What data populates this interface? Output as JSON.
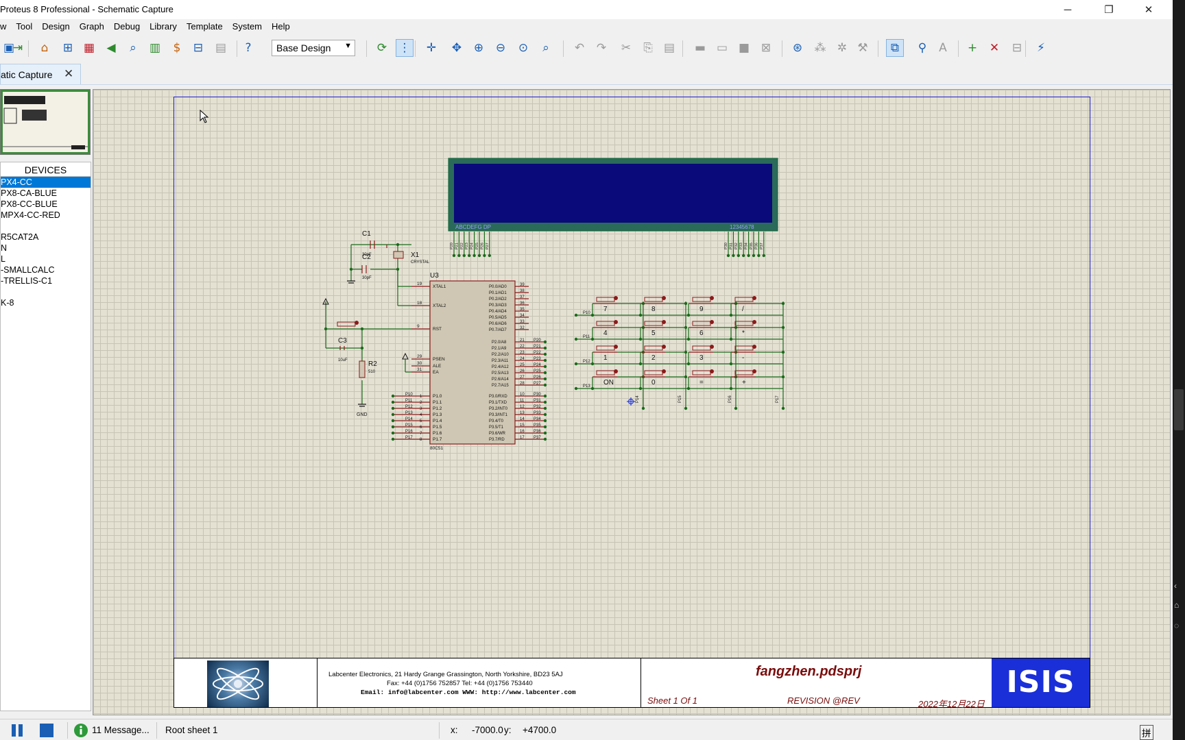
{
  "window": {
    "title": "Proteus 8 Professional - Schematic Capture",
    "minimize": "─",
    "maximize": "❐",
    "close": "✕"
  },
  "menu": [
    "w",
    "Tool",
    "Design",
    "Graph",
    "Debug",
    "Library",
    "Template",
    "System",
    "Help"
  ],
  "toolbar": {
    "design_select": "Base Design",
    "icons": [
      "save-icon",
      "import-icon",
      "home-icon",
      "pcb-icon",
      "chip-icon",
      "back-icon",
      "zoom-search-icon",
      "gerber-icon",
      "bom-icon",
      "binary-icon",
      "document-icon",
      "help-icon",
      "refresh-icon",
      "grid-icon",
      "origin-icon",
      "pan-icon",
      "zoom-in-icon",
      "zoom-out-icon",
      "zoom-all-icon",
      "zoom-area-icon",
      "undo-icon",
      "redo-icon",
      "cut-icon",
      "copy-icon",
      "paste-icon",
      "block-copy-icon",
      "block-move-icon",
      "block-rotate-icon",
      "block-delete-icon",
      "pick-device-icon",
      "make-device-icon",
      "package-tool-icon",
      "decompose-icon",
      "wire-autorouter-icon",
      "search-tag-icon",
      "property-assign-icon",
      "new-sheet-icon",
      "remove-sheet-icon",
      "exit-parent-icon",
      "electrical-rule-icon"
    ]
  },
  "tab": {
    "label": "atic Capture",
    "close": "✕"
  },
  "devices": {
    "header": "DEVICES",
    "items": [
      "PX4-CC",
      "PX8-CA-BLUE",
      "PX8-CC-BLUE",
      "MPX4-CC-RED",
      "",
      "R5CAT2A",
      "N",
      "L",
      "-SMALLCALC",
      "-TRELLIS-C1",
      "",
      "K-8"
    ],
    "selected_index": 0
  },
  "schematic": {
    "lcd": {
      "left_label": "ABCDEFG DP",
      "right_label": "12345678",
      "color": "#0a0a7a"
    },
    "components": {
      "c1": "C1",
      "c1_val": "30pF",
      "c2": "C2",
      "c2_val": "30pF",
      "x1": "X1",
      "x1_val": "CRYSTAL",
      "c3": "C3",
      "c3_val": "10uF",
      "r2": "R2",
      "r2_val": "510",
      "gnd": "GND",
      "u3": "U3",
      "u3_part": "80C51"
    },
    "mcu_left_pins": [
      {
        "num": "19",
        "name": "XTAL1"
      },
      {
        "num": "18",
        "name": "XTAL2"
      },
      {
        "num": "9",
        "name": "RST"
      },
      {
        "num": "29",
        "name": "PSEN"
      },
      {
        "num": "30",
        "name": "ALE"
      },
      {
        "num": "31",
        "name": "EA"
      }
    ],
    "mcu_p1_pins": [
      {
        "num": "1",
        "name": "P1.0",
        "net": "P10"
      },
      {
        "num": "2",
        "name": "P1.1",
        "net": "P11"
      },
      {
        "num": "3",
        "name": "P1.2",
        "net": "P12"
      },
      {
        "num": "4",
        "name": "P1.3",
        "net": "P13"
      },
      {
        "num": "5",
        "name": "P1.4",
        "net": "P14"
      },
      {
        "num": "6",
        "name": "P1.5",
        "net": "P15"
      },
      {
        "num": "7",
        "name": "P1.6",
        "net": "P16"
      },
      {
        "num": "8",
        "name": "P1.7",
        "net": "P17"
      }
    ],
    "mcu_p0_pins": [
      {
        "num": "39",
        "name": "P0.0/AD0"
      },
      {
        "num": "38",
        "name": "P0.1/AD1"
      },
      {
        "num": "37",
        "name": "P0.2/AD2"
      },
      {
        "num": "36",
        "name": "P0.3/AD3"
      },
      {
        "num": "35",
        "name": "P0.4/AD4"
      },
      {
        "num": "34",
        "name": "P0.5/AD5"
      },
      {
        "num": "33",
        "name": "P0.6/AD6"
      },
      {
        "num": "32",
        "name": "P0.7/AD7"
      }
    ],
    "mcu_p2_pins": [
      {
        "num": "21",
        "name": "P2.0/A8",
        "net": "P20"
      },
      {
        "num": "22",
        "name": "P2.1/A9",
        "net": "P21"
      },
      {
        "num": "23",
        "name": "P2.2/A10",
        "net": "P22"
      },
      {
        "num": "24",
        "name": "P2.3/A11",
        "net": "P23"
      },
      {
        "num": "25",
        "name": "P2.4/A12",
        "net": "P24"
      },
      {
        "num": "26",
        "name": "P2.5/A13",
        "net": "P25"
      },
      {
        "num": "27",
        "name": "P2.6/A14",
        "net": "P26"
      },
      {
        "num": "28",
        "name": "P2.7/A15",
        "net": "P27"
      }
    ],
    "mcu_p3_pins": [
      {
        "num": "10",
        "name": "P3.0/RXD",
        "net": "P30"
      },
      {
        "num": "11",
        "name": "P3.1/TXD",
        "net": "P31"
      },
      {
        "num": "12",
        "name": "P3.2/INT0",
        "net": "P32"
      },
      {
        "num": "13",
        "name": "P3.3/INT1",
        "net": "P33"
      },
      {
        "num": "14",
        "name": "P3.4/T0",
        "net": "P34"
      },
      {
        "num": "15",
        "name": "P3.5/T1",
        "net": "P35"
      },
      {
        "num": "16",
        "name": "P3.6/WR",
        "net": "P36"
      },
      {
        "num": "17",
        "name": "P3.7/RD",
        "net": "P37"
      }
    ],
    "keypad_rows": [
      {
        "net": "P10",
        "keys": [
          "7",
          "8",
          "9",
          "/"
        ]
      },
      {
        "net": "P11",
        "keys": [
          "4",
          "5",
          "6",
          "*"
        ]
      },
      {
        "net": "P12",
        "keys": [
          "1",
          "2",
          "3",
          "-"
        ]
      },
      {
        "net": "P13",
        "keys": [
          "ON",
          "0",
          "=",
          "+"
        ]
      }
    ],
    "keypad_cols": [
      "P14",
      "P15",
      "P16",
      "P17"
    ],
    "lcd_left_nets": [
      "P20",
      "P21",
      "P22",
      "P23",
      "P24",
      "P25",
      "P26",
      "P27"
    ],
    "lcd_right_nets": [
      "P30",
      "P31",
      "P32",
      "P33",
      "P34",
      "P35",
      "P36",
      "P37"
    ]
  },
  "titleblock": {
    "addr_line1": "Labcenter Electronics,      21 Hardy Grange      Grassington,     North Yorkshire,      BD23 5AJ",
    "addr_line2": "Fax: +44 (0)1756 752857           Tel:  +44 (0)1756 753440",
    "addr_line3": "Email:   info@labcenter.com           WWW:   http://www.labcenter.com",
    "filename": "fangzhen.pdsprj",
    "sheet": "Sheet  1    Of  1",
    "revision": "REVISION  @REV",
    "date": "2022年12月22日",
    "logo_text": "ISIS"
  },
  "status": {
    "messages": "11 Message...",
    "sheet": "Root sheet 1",
    "x_label": "x:",
    "x_value": "-7000.0",
    "y_label": "y:",
    "y_value": "+4700.0",
    "ime": "拼"
  },
  "colors": {
    "sheet_border": "#1c1cd0",
    "component_outline": "#8b1a1a",
    "component_fill": "#cfc7b3",
    "wire": "#1a6b1a",
    "junction": "#1a6b1a",
    "selection": "#0078d7"
  }
}
